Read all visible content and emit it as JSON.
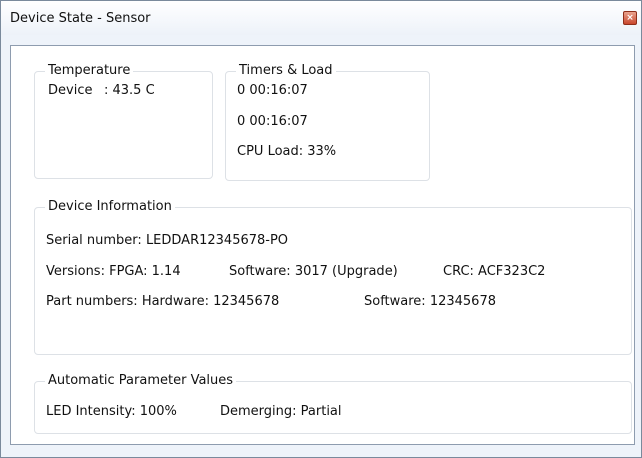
{
  "window": {
    "title": "Device State - Sensor",
    "close_glyph": "×"
  },
  "temperature": {
    "title": "Temperature",
    "device_label": "Device",
    "device_value": ": 43.5 C"
  },
  "timers": {
    "title": "Timers & Load",
    "timer1": "0 00:16:07",
    "timer2": "0 00:16:07",
    "cpu_load": "CPU Load: 33%"
  },
  "device_info": {
    "title": "Device Information",
    "serial": "Serial number: LEDDAR12345678-PO",
    "versions_fpga": "Versions: FPGA: 1.14",
    "versions_software": "Software: 3017 (Upgrade)",
    "versions_crc": "CRC: ACF323C2",
    "part_hardware": "Part numbers: Hardware: 12345678",
    "part_software": "Software: 12345678"
  },
  "auto_params": {
    "title": "Automatic Parameter Values",
    "led_intensity": "LED Intensity: 100%",
    "demerging": "Demerging: Partial"
  }
}
